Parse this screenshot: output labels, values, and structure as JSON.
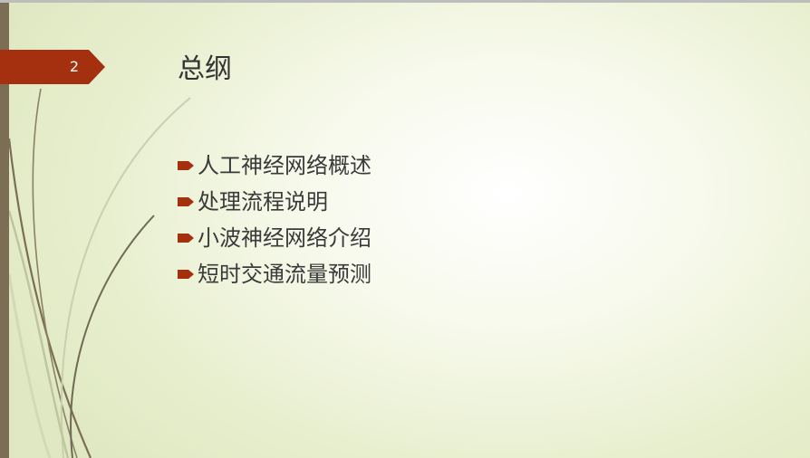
{
  "slide": {
    "number": "2",
    "title": "总纲",
    "bullets": [
      {
        "text": "人工神经网络概述"
      },
      {
        "text": "处理流程说明"
      },
      {
        "text": "小波神经网络介绍"
      },
      {
        "text": "短时交通流量预测"
      }
    ]
  },
  "colors": {
    "accent": "#a5300f",
    "side_bar": "#7b6e54",
    "text": "#3a3a3a",
    "background": "#e8efcf"
  },
  "icons": {
    "bullet": "arrow-bullet-icon",
    "number_badge": "arrow-badge-shape"
  }
}
